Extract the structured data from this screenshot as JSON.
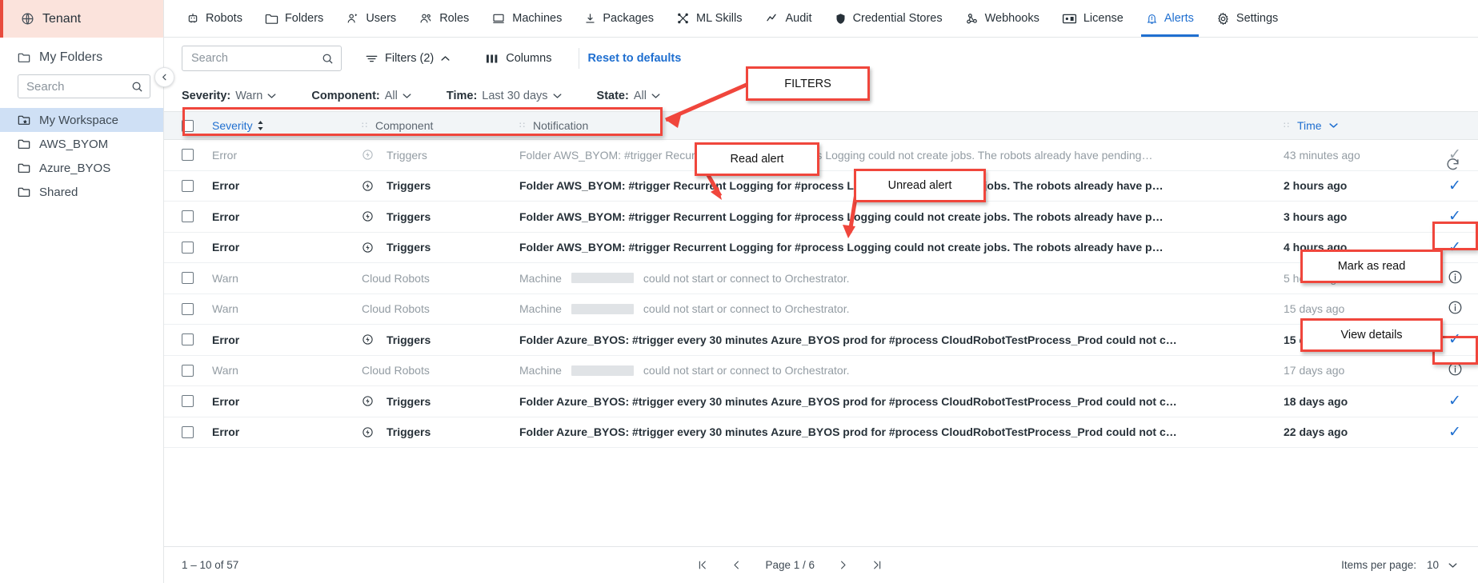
{
  "sidebar": {
    "tenant_label": "Tenant",
    "my_folders_label": "My Folders",
    "search_placeholder": "Search",
    "search_value": "",
    "folders": [
      {
        "label": "My Workspace",
        "icon": "workspace-folder-icon",
        "active": true
      },
      {
        "label": "AWS_BYOM",
        "icon": "folder-icon",
        "active": false
      },
      {
        "label": "Azure_BYOS",
        "icon": "folder-icon",
        "active": false
      },
      {
        "label": "Shared",
        "icon": "folder-icon",
        "active": false
      }
    ]
  },
  "topnav": {
    "items": [
      {
        "label": "Robots",
        "icon": "robot-icon",
        "active": false
      },
      {
        "label": "Folders",
        "icon": "folder-icon",
        "active": false
      },
      {
        "label": "Users",
        "icon": "user-icon",
        "active": false
      },
      {
        "label": "Roles",
        "icon": "roles-icon",
        "active": false
      },
      {
        "label": "Machines",
        "icon": "machine-icon",
        "active": false
      },
      {
        "label": "Packages",
        "icon": "package-download-icon",
        "active": false
      },
      {
        "label": "ML Skills",
        "icon": "ml-skills-icon",
        "active": false
      },
      {
        "label": "Audit",
        "icon": "audit-chart-icon",
        "active": false
      },
      {
        "label": "Credential Stores",
        "icon": "shield-icon",
        "active": false
      },
      {
        "label": "Webhooks",
        "icon": "webhook-icon",
        "active": false
      },
      {
        "label": "License",
        "icon": "license-icon",
        "active": false
      },
      {
        "label": "Alerts",
        "icon": "bell-alert-icon",
        "active": true
      },
      {
        "label": "Settings",
        "icon": "gear-icon",
        "active": false
      }
    ]
  },
  "toolbar": {
    "search_placeholder": "Search",
    "search_value": "",
    "filters_label": "Filters (2)",
    "columns_label": "Columns",
    "reset_label": "Reset to defaults"
  },
  "filters": [
    {
      "key": "Severity:",
      "value": "Warn"
    },
    {
      "key": "Component:",
      "value": "All"
    },
    {
      "key": "Time:",
      "value": "Last 30 days"
    },
    {
      "key": "State:",
      "value": "All"
    }
  ],
  "table": {
    "headers": {
      "severity": "Severity",
      "component": "Component",
      "notification": "Notification",
      "time": "Time"
    },
    "rows": [
      {
        "severity": "Error",
        "component": "Triggers",
        "component_icon": "trigger-icon",
        "notification": "Folder AWS_BYOM: #trigger Recurrent Logging for #process Logging could not create jobs. The robots already have pending…",
        "time": "43 minutes ago",
        "state": "read",
        "action": "mark-read-check",
        "redacted": false
      },
      {
        "severity": "Error",
        "component": "Triggers",
        "component_icon": "trigger-icon",
        "notification": "Folder AWS_BYOM: #trigger Recurrent Logging for #process Logging could not create jobs. The robots already have p…",
        "time": "2 hours ago",
        "state": "unread",
        "action": "mark-read-check",
        "redacted": false
      },
      {
        "severity": "Error",
        "component": "Triggers",
        "component_icon": "trigger-icon",
        "notification": "Folder AWS_BYOM: #trigger Recurrent Logging for #process Logging could not create jobs. The robots already have p…",
        "time": "3 hours ago",
        "state": "unread",
        "action": "mark-read-check",
        "redacted": false
      },
      {
        "severity": "Error",
        "component": "Triggers",
        "component_icon": "trigger-icon",
        "notification": "Folder AWS_BYOM: #trigger Recurrent Logging for #process Logging could not create jobs. The robots already have p…",
        "time": "4 hours ago",
        "state": "unread",
        "action": "mark-read-check",
        "redacted": false
      },
      {
        "severity": "Warn",
        "component": "Cloud Robots",
        "component_icon": "",
        "notification_prefix": "Machine",
        "notification_suffix": "could not start or connect to Orchestrator.",
        "time": "5 hours ago",
        "state": "read",
        "action": "info",
        "redacted": true
      },
      {
        "severity": "Warn",
        "component": "Cloud Robots",
        "component_icon": "",
        "notification_prefix": "Machine",
        "notification_suffix": "could not start or connect to Orchestrator.",
        "time": "15 days ago",
        "state": "read",
        "action": "info",
        "redacted": true
      },
      {
        "severity": "Error",
        "component": "Triggers",
        "component_icon": "trigger-icon",
        "notification": "Folder Azure_BYOS: #trigger every 30 minutes Azure_BYOS prod for #process CloudRobotTestProcess_Prod could not c…",
        "time": "15 days ago",
        "state": "unread",
        "action": "mark-read-check",
        "redacted": false
      },
      {
        "severity": "Warn",
        "component": "Cloud Robots",
        "component_icon": "",
        "notification_prefix": "Machine",
        "notification_suffix": "could not start or connect to Orchestrator.",
        "time": "17 days ago",
        "state": "read",
        "action": "info",
        "redacted": true
      },
      {
        "severity": "Error",
        "component": "Triggers",
        "component_icon": "trigger-icon",
        "notification": "Folder Azure_BYOS: #trigger every 30 minutes Azure_BYOS prod for #process CloudRobotTestProcess_Prod could not c…",
        "time": "18 days ago",
        "state": "unread",
        "action": "mark-read-check",
        "redacted": false
      },
      {
        "severity": "Error",
        "component": "Triggers",
        "component_icon": "trigger-icon",
        "notification": "Folder Azure_BYOS: #trigger every 30 minutes Azure_BYOS prod for #process CloudRobotTestProcess_Prod could not c…",
        "time": "22 days ago",
        "state": "unread",
        "action": "mark-read-check",
        "redacted": false
      }
    ]
  },
  "pagination": {
    "range_label": "1 – 10 of 57",
    "page_label": "Page 1 / 6",
    "items_per_page_label": "Items per page:",
    "items_per_page_value": "10"
  },
  "annotations": [
    {
      "label": "FILTERS"
    },
    {
      "label": "Read alert"
    },
    {
      "label": "Unread alert"
    },
    {
      "label": "Mark as read"
    },
    {
      "label": "View details"
    }
  ],
  "colors": {
    "accent_blue": "#1f6fd0",
    "annotation_red": "#f0463c",
    "tenant_bg": "#fbe3dc",
    "active_folder": "#cfe0f5"
  }
}
